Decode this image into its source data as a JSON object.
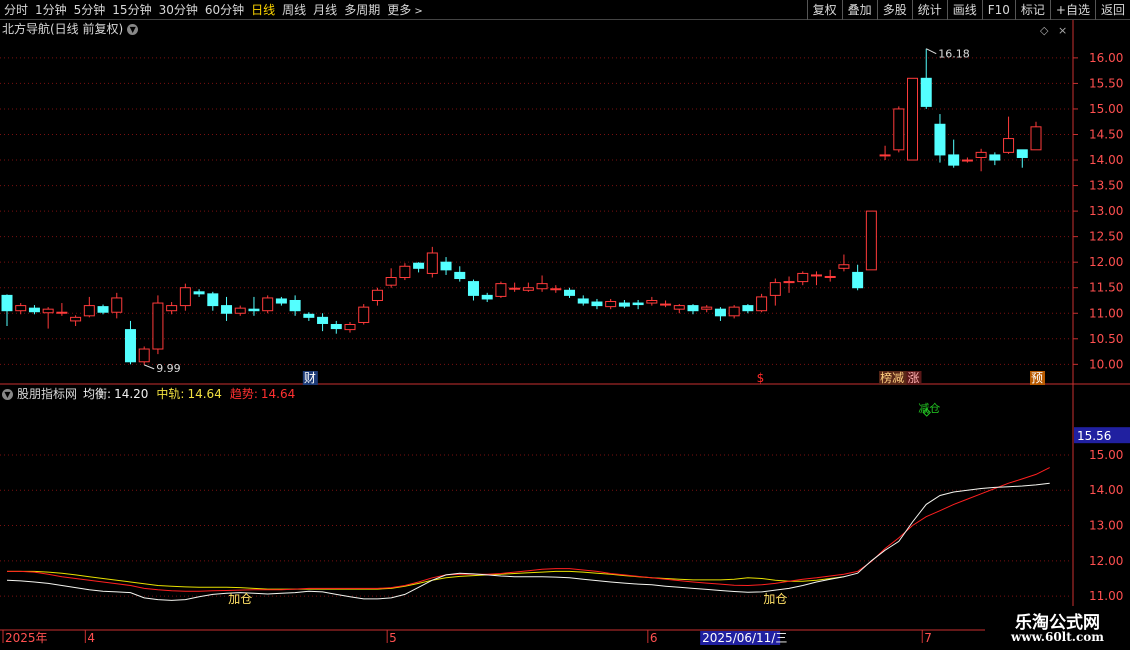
{
  "toolbar": {
    "periods": [
      {
        "label": "分时",
        "active": false
      },
      {
        "label": "1分钟",
        "active": false
      },
      {
        "label": "5分钟",
        "active": false
      },
      {
        "label": "15分钟",
        "active": false
      },
      {
        "label": "30分钟",
        "active": false
      },
      {
        "label": "60分钟",
        "active": false
      },
      {
        "label": "日线",
        "active": true
      },
      {
        "label": "周线",
        "active": false
      },
      {
        "label": "月线",
        "active": false
      },
      {
        "label": "多周期",
        "active": false
      }
    ],
    "more_label": "更多",
    "actions": [
      "复权",
      "叠加",
      "多股",
      "统计",
      "画线",
      "F10",
      "标记",
      "+自选",
      "返回"
    ]
  },
  "main_header": {
    "title": "北方导航(日线 前复权)"
  },
  "indicator_header": {
    "name": "股朋指标网",
    "junheng_label": "均衡:",
    "junheng_value": "14.20",
    "zhonggui_label": "中轨:",
    "zhonggui_value": "14.64",
    "qushi_label": "趋势:",
    "qushi_value": "14.64"
  },
  "colors": {
    "up": "#ff3b3b",
    "down": "#54ffff",
    "grid": "#7a1010",
    "white_line": "#f5f5f0",
    "red_line": "#ff2020",
    "yellow_line": "#e8e000",
    "axis": "#c83030",
    "label": "#ffe066",
    "highlight_bg": "#2020a0"
  },
  "chart_data": {
    "type": "candlestick",
    "ylim": [
      9.85,
      16.35
    ],
    "yticks": [
      "16.00",
      "15.50",
      "15.00",
      "14.50",
      "14.00",
      "13.50",
      "13.00",
      "12.50",
      "12.00",
      "11.50",
      "11.00",
      "10.50",
      "10.00"
    ],
    "high_annotation": "16.18",
    "low_annotation": "9.99",
    "candles": [
      [
        11.35,
        11.05,
        11.37,
        10.75
      ],
      [
        11.05,
        11.15,
        11.2,
        10.98
      ],
      [
        11.1,
        11.03,
        11.16,
        10.98
      ],
      [
        11.01,
        11.08,
        11.12,
        10.7
      ],
      [
        11.02,
        11.02,
        11.2,
        10.95
      ],
      [
        10.85,
        10.92,
        10.96,
        10.75
      ],
      [
        10.95,
        11.15,
        11.32,
        10.92
      ],
      [
        11.13,
        11.02,
        11.17,
        10.98
      ],
      [
        11.02,
        11.3,
        11.4,
        10.9
      ],
      [
        10.68,
        10.05,
        10.85,
        10.0
      ],
      [
        10.05,
        10.3,
        10.35,
        9.99
      ],
      [
        10.3,
        11.2,
        11.35,
        10.2
      ],
      [
        11.05,
        11.15,
        11.22,
        10.98
      ],
      [
        11.15,
        11.5,
        11.58,
        11.05
      ],
      [
        11.42,
        11.38,
        11.47,
        11.32
      ],
      [
        11.38,
        11.15,
        11.42,
        11.05
      ],
      [
        11.15,
        11.0,
        11.32,
        10.85
      ],
      [
        11.0,
        11.1,
        11.15,
        10.95
      ],
      [
        11.08,
        11.05,
        11.32,
        10.95
      ],
      [
        11.05,
        11.3,
        11.35,
        11.0
      ],
      [
        11.28,
        11.2,
        11.32,
        11.15
      ],
      [
        11.25,
        11.05,
        11.35,
        10.95
      ],
      [
        10.98,
        10.92,
        11.02,
        10.85
      ],
      [
        10.92,
        10.8,
        11.0,
        10.65
      ],
      [
        10.78,
        10.7,
        10.85,
        10.6
      ],
      [
        10.68,
        10.78,
        10.83,
        10.62
      ],
      [
        10.82,
        11.12,
        11.18,
        10.78
      ],
      [
        11.25,
        11.45,
        11.5,
        11.15
      ],
      [
        11.55,
        11.7,
        11.88,
        11.5
      ],
      [
        11.7,
        11.92,
        11.98,
        11.65
      ],
      [
        11.98,
        11.88,
        12.0,
        11.8
      ],
      [
        11.78,
        12.18,
        12.3,
        11.7
      ],
      [
        12.0,
        11.85,
        12.1,
        11.75
      ],
      [
        11.8,
        11.68,
        11.92,
        11.62
      ],
      [
        11.62,
        11.35,
        11.66,
        11.25
      ],
      [
        11.35,
        11.28,
        11.4,
        11.22
      ],
      [
        11.33,
        11.58,
        11.62,
        11.3
      ],
      [
        11.49,
        11.49,
        11.6,
        11.42
      ],
      [
        11.45,
        11.5,
        11.6,
        11.42
      ],
      [
        11.48,
        11.58,
        11.74,
        11.42
      ],
      [
        11.48,
        11.48,
        11.55,
        11.4
      ],
      [
        11.45,
        11.35,
        11.5,
        11.3
      ],
      [
        11.28,
        11.2,
        11.35,
        11.15
      ],
      [
        11.22,
        11.15,
        11.28,
        11.08
      ],
      [
        11.13,
        11.23,
        11.28,
        11.08
      ],
      [
        11.2,
        11.14,
        11.26,
        11.1
      ],
      [
        11.2,
        11.17,
        11.26,
        11.08
      ],
      [
        11.2,
        11.25,
        11.32,
        11.15
      ],
      [
        11.18,
        11.18,
        11.25,
        11.12
      ],
      [
        11.08,
        11.15,
        11.18,
        11.0
      ],
      [
        11.15,
        11.05,
        11.18,
        10.98
      ],
      [
        11.08,
        11.12,
        11.16,
        11.02
      ],
      [
        11.08,
        10.95,
        11.12,
        10.85
      ],
      [
        10.95,
        11.12,
        11.16,
        10.9
      ],
      [
        11.15,
        11.05,
        11.18,
        11.0
      ],
      [
        11.05,
        11.32,
        11.38,
        11.02
      ],
      [
        11.35,
        11.6,
        11.68,
        11.15
      ],
      [
        11.6,
        11.62,
        11.72,
        11.4
      ],
      [
        11.62,
        11.78,
        11.82,
        11.55
      ],
      [
        11.75,
        11.75,
        11.82,
        11.55
      ],
      [
        11.72,
        11.72,
        11.85,
        11.62
      ],
      [
        11.88,
        11.95,
        12.15,
        11.82
      ],
      [
        11.8,
        11.5,
        11.95,
        11.45
      ],
      [
        11.85,
        13.0,
        13.0,
        11.85
      ],
      [
        14.1,
        14.1,
        14.28,
        14.0
      ],
      [
        14.2,
        15.0,
        15.05,
        14.15
      ],
      [
        14.0,
        15.6,
        15.6,
        14.0
      ],
      [
        15.6,
        15.05,
        16.18,
        15.0
      ],
      [
        14.7,
        14.1,
        14.9,
        13.95
      ],
      [
        14.1,
        13.9,
        14.4,
        13.85
      ],
      [
        14.0,
        14.0,
        14.05,
        13.95
      ],
      [
        14.05,
        14.15,
        14.22,
        13.78
      ],
      [
        14.1,
        14.0,
        14.15,
        13.9
      ],
      [
        14.15,
        14.42,
        14.85,
        14.12
      ],
      [
        14.2,
        14.05,
        14.2,
        13.85
      ],
      [
        14.2,
        14.65,
        14.75,
        14.2
      ]
    ],
    "markers": [
      {
        "text": "财",
        "index": 22,
        "bg": "#1e3c78",
        "color": "#ffffff"
      },
      {
        "text": "$",
        "index": 55,
        "bg": "",
        "color": "#ff2a2a"
      },
      {
        "text": "榜减",
        "index": 64,
        "bg": "#5a2818",
        "color": "#ffd080"
      },
      {
        "text": "涨",
        "index": 66,
        "bg": "#5a1818",
        "color": "#ffb0b0"
      },
      {
        "text": "预",
        "index": 75,
        "bg": "#b85a00",
        "color": "#ffffff"
      }
    ],
    "indicator": {
      "ylim": [
        10.55,
        16.5
      ],
      "yticks": [
        "15.00",
        "14.00",
        "13.00",
        "12.00",
        "11.00"
      ],
      "highlight_value": "15.56",
      "junheng": [
        11.45,
        11.43,
        11.4,
        11.36,
        11.3,
        11.24,
        11.18,
        11.14,
        11.12,
        11.1,
        10.95,
        10.9,
        10.88,
        10.9,
        10.98,
        11.05,
        11.08,
        11.1,
        11.08,
        11.06,
        11.08,
        11.1,
        11.14,
        11.12,
        11.05,
        10.98,
        10.92,
        10.92,
        10.95,
        11.05,
        11.25,
        11.45,
        11.6,
        11.65,
        11.63,
        11.6,
        11.57,
        11.55,
        11.55,
        11.55,
        11.54,
        11.52,
        11.48,
        11.44,
        11.4,
        11.37,
        11.34,
        11.32,
        11.28,
        11.25,
        11.22,
        11.19,
        11.16,
        11.13,
        11.11,
        11.12,
        11.17,
        11.22,
        11.3,
        11.4,
        11.48,
        11.55,
        11.65,
        12.0,
        12.3,
        12.55,
        13.1,
        13.6,
        13.85,
        13.95,
        14.0,
        14.05,
        14.08,
        14.1,
        14.12,
        14.15,
        14.2
      ],
      "zhonggui": [
        11.7,
        11.7,
        11.68,
        11.62,
        11.55,
        11.5,
        11.45,
        11.4,
        11.35,
        11.3,
        11.22,
        11.18,
        11.15,
        11.14,
        11.14,
        11.15,
        11.16,
        11.17,
        11.18,
        11.18,
        11.18,
        11.2,
        11.22,
        11.22,
        11.22,
        11.22,
        11.22,
        11.22,
        11.24,
        11.3,
        11.4,
        11.52,
        11.6,
        11.62,
        11.62,
        11.62,
        11.64,
        11.68,
        11.72,
        11.76,
        11.78,
        11.78,
        11.74,
        11.7,
        11.64,
        11.6,
        11.56,
        11.52,
        11.48,
        11.44,
        11.4,
        11.37,
        11.34,
        11.31,
        11.3,
        11.32,
        11.36,
        11.42,
        11.48,
        11.52,
        11.57,
        11.62,
        11.7,
        11.98,
        12.35,
        12.65,
        13.0,
        13.25,
        13.42,
        13.6,
        13.75,
        13.9,
        14.05,
        14.2,
        14.32,
        14.45,
        14.64
      ],
      "yellow": [
        11.7,
        11.7,
        11.7,
        11.68,
        11.65,
        11.6,
        11.55,
        11.5,
        11.45,
        11.4,
        11.35,
        11.3,
        11.28,
        11.26,
        11.25,
        11.25,
        11.25,
        11.24,
        11.22,
        11.2,
        11.2,
        11.2,
        11.2,
        11.2,
        11.2,
        11.2,
        11.2,
        11.2,
        11.22,
        11.28,
        11.36,
        11.45,
        11.52,
        11.56,
        11.58,
        11.6,
        11.62,
        11.64,
        11.66,
        11.68,
        11.7,
        11.7,
        11.68,
        11.65,
        11.62,
        11.58,
        11.55,
        11.52,
        11.5,
        11.48,
        11.46,
        11.46,
        11.46,
        11.48,
        11.52,
        11.5,
        11.45,
        11.42,
        11.42,
        11.45,
        11.5,
        11.55
      ],
      "labels": [
        {
          "text": "加仓",
          "index": 17
        },
        {
          "text": "加仓",
          "index": 56
        }
      ],
      "signal": {
        "text": "减仓",
        "index": 67
      }
    },
    "xaxis": {
      "labels": [
        {
          "text": "2025年",
          "index": 0
        },
        {
          "text": "4",
          "index": 6
        },
        {
          "text": "5",
          "index": 28
        },
        {
          "text": "6",
          "index": 47
        },
        {
          "text": "7",
          "index": 67
        }
      ],
      "highlight": "2025/06/11/三",
      "highlight_index": 53
    }
  },
  "watermark": {
    "title": "乐淘公式网",
    "url": "www.60lt.com"
  }
}
